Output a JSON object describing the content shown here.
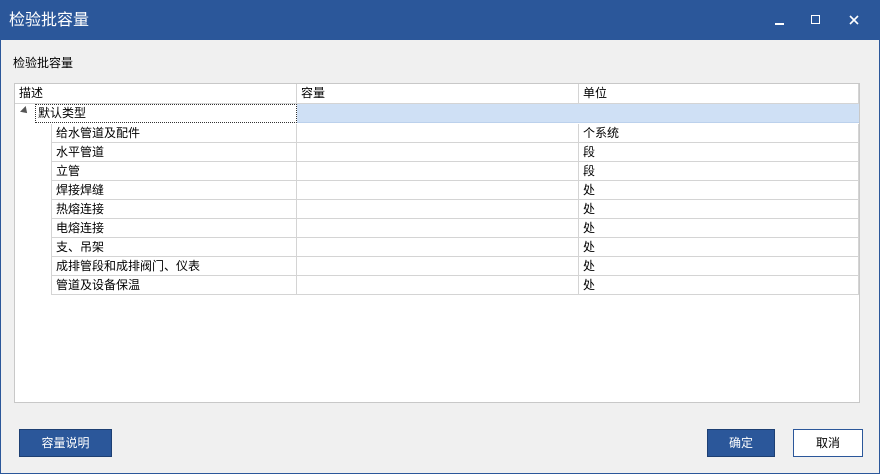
{
  "window": {
    "title": "检验批容量"
  },
  "section_label": "检验批容量",
  "table": {
    "columns": [
      "描述",
      "容量",
      "单位"
    ],
    "group": {
      "label": "默认类型",
      "expanded": true
    },
    "rows": [
      {
        "desc": "给水管道及配件",
        "capacity": "",
        "unit": "个系统"
      },
      {
        "desc": "水平管道",
        "capacity": "",
        "unit": "段"
      },
      {
        "desc": "立管",
        "capacity": "",
        "unit": "段"
      },
      {
        "desc": "焊接焊缝",
        "capacity": "",
        "unit": "处"
      },
      {
        "desc": "热熔连接",
        "capacity": "",
        "unit": "处"
      },
      {
        "desc": "电熔连接",
        "capacity": "",
        "unit": "处"
      },
      {
        "desc": "支、吊架",
        "capacity": "",
        "unit": "处"
      },
      {
        "desc": "成排管段和成排阀门、仪表",
        "capacity": "",
        "unit": "处"
      },
      {
        "desc": "管道及设备保温",
        "capacity": "",
        "unit": "处"
      }
    ]
  },
  "buttons": {
    "help": "容量说明",
    "ok": "确定",
    "cancel": "取消"
  },
  "icons": {
    "minimize": "minimize-icon",
    "maximize": "maximize-icon",
    "close": "close-icon",
    "expander": "expand-triangle-icon"
  },
  "colors": {
    "accent": "#2b579a",
    "selection": "#cfe0f5"
  }
}
